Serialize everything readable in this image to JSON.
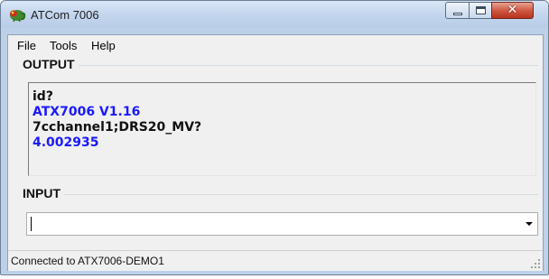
{
  "window": {
    "title": "ATCom 7006"
  },
  "menu": {
    "items": [
      "File",
      "Tools",
      "Help"
    ]
  },
  "output": {
    "heading": "OUTPUT",
    "lines": [
      {
        "text": "id?",
        "color": "#111111"
      },
      {
        "text": "ATX7006 V1.16",
        "color": "#1a1aff"
      },
      {
        "text": "7cchannel1;DRS20_MV?",
        "color": "#111111"
      },
      {
        "text": "4.002935",
        "color": "#1a1aff"
      }
    ]
  },
  "input": {
    "heading": "INPUT",
    "value": ""
  },
  "status": {
    "text": "Connected to ATX7006-DEMO1"
  },
  "icons": {
    "app": "chameleon-app-icon",
    "minimize": "minimize-icon",
    "maximize": "maximize-icon",
    "close": "close-icon",
    "dropdown": "chevron-down-icon",
    "resize": "resize-grip-icon"
  }
}
